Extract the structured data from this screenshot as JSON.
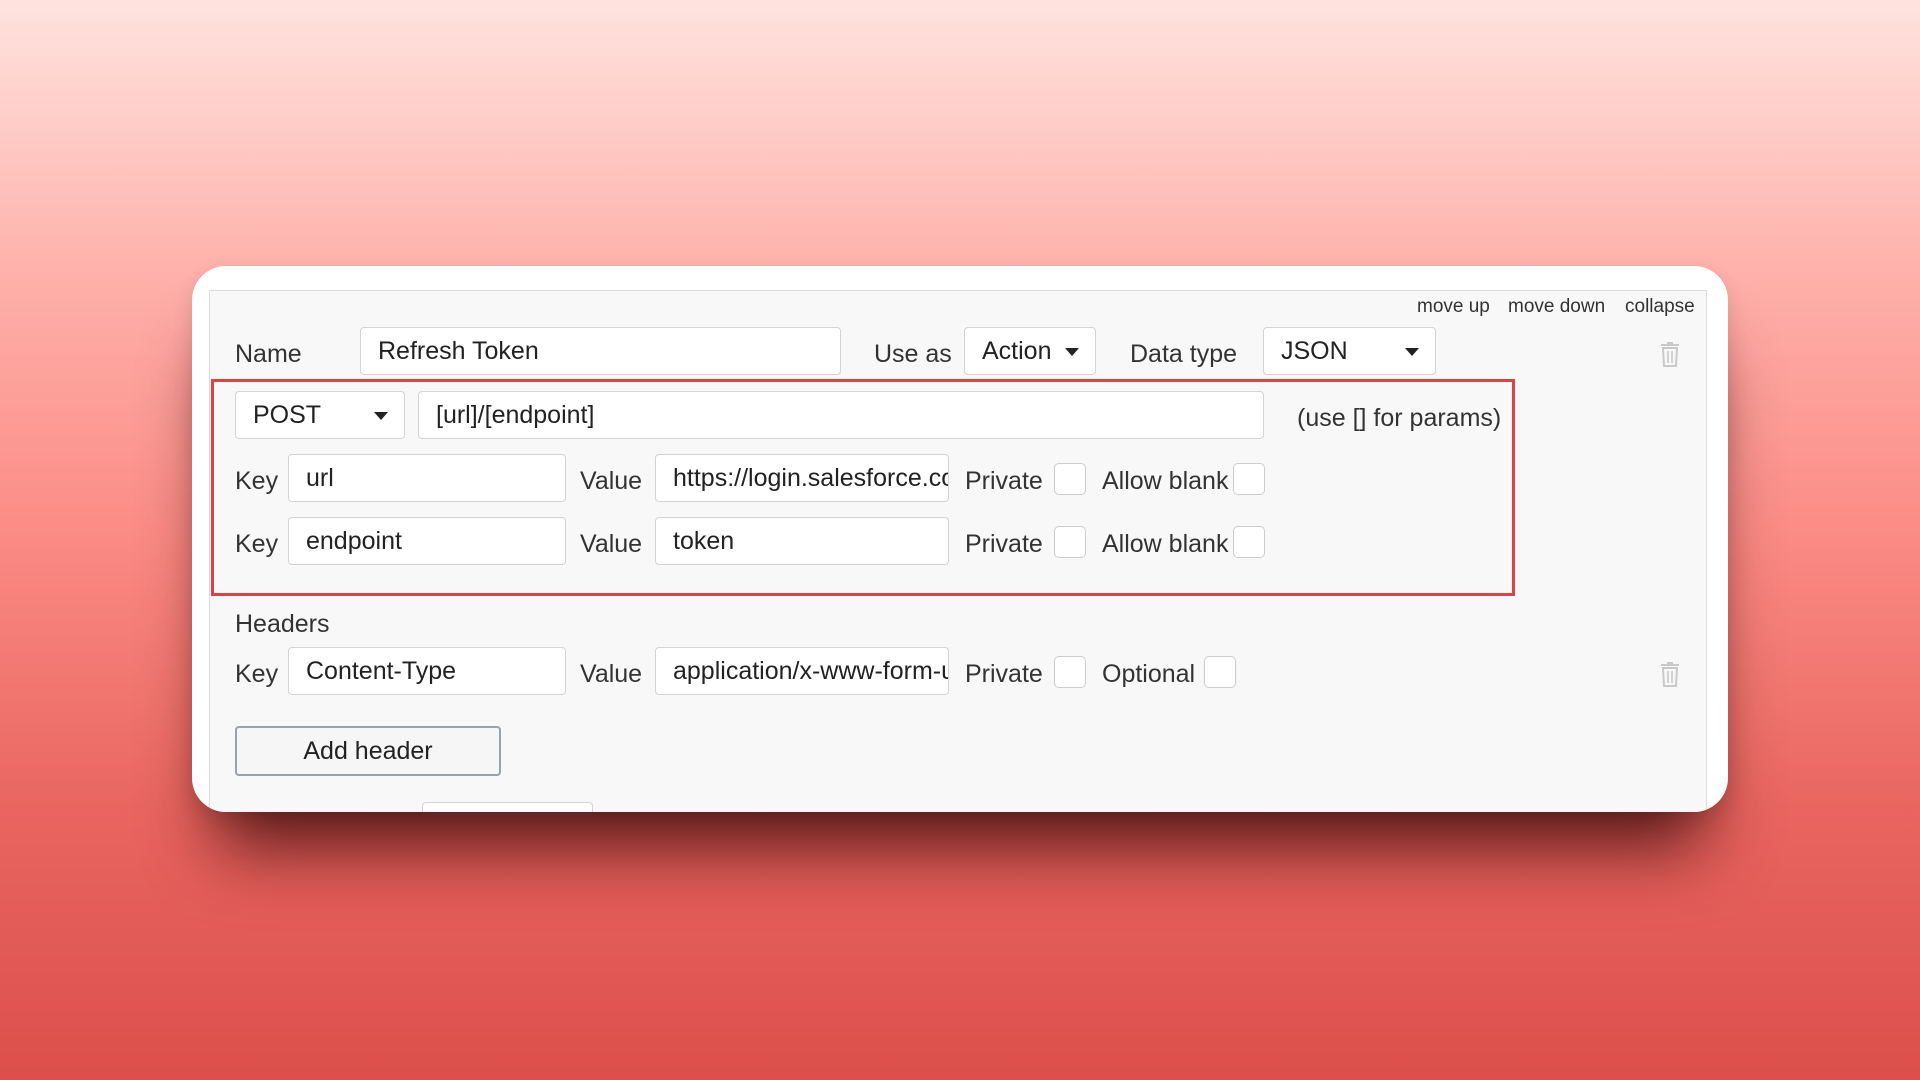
{
  "controls": {
    "move_up": "move up",
    "move_down": "move down",
    "collapse": "collapse"
  },
  "call": {
    "name_label": "Name",
    "name_value": "Refresh Token",
    "use_as_label": "Use as",
    "use_as_value": "Action",
    "data_type_label": "Data type",
    "data_type_value": "JSON"
  },
  "request": {
    "method": "POST",
    "url": "[url]/[endpoint]",
    "hint": "(use [] for params)",
    "params": [
      {
        "key_label": "Key",
        "key": "url",
        "value_label": "Value",
        "value": "https://login.salesforce.com",
        "private_label": "Private",
        "allow_blank_label": "Allow blank"
      },
      {
        "key_label": "Key",
        "key": "endpoint",
        "value_label": "Value",
        "value": "token",
        "private_label": "Private",
        "allow_blank_label": "Allow blank"
      }
    ]
  },
  "headers": {
    "title": "Headers",
    "items": [
      {
        "key_label": "Key",
        "key": "Content-Type",
        "value_label": "Value",
        "value": "application/x-www-form-urlencoded",
        "private_label": "Private",
        "optional_label": "Optional"
      }
    ],
    "add_label": "Add header"
  },
  "icons": {
    "delete": "trash-icon",
    "dropdown": "caret-down-icon"
  },
  "colors": {
    "highlight": "#d94545",
    "panel_bg": "#f8f8f8"
  }
}
